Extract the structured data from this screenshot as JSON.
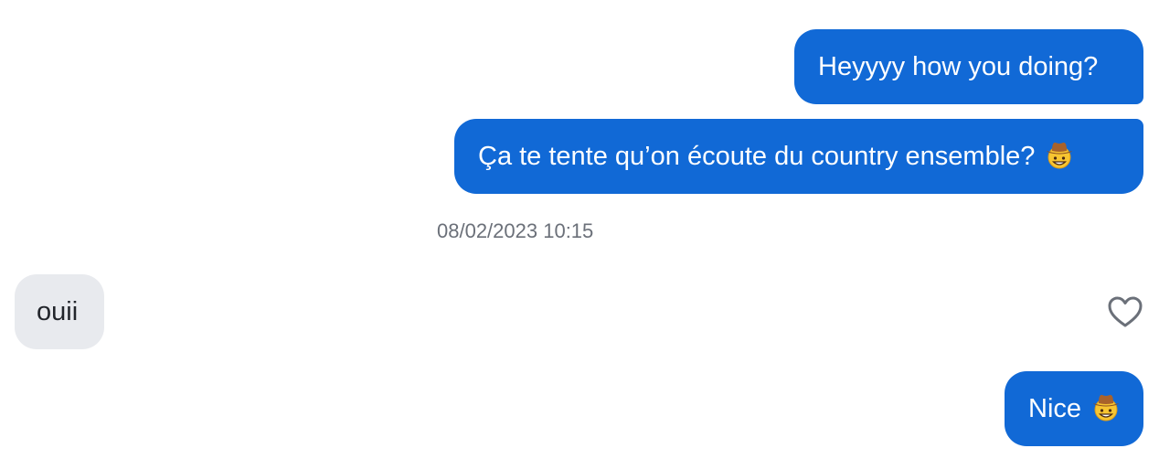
{
  "messages": [
    {
      "text": "Heyyyy how you doing?",
      "direction": "sent",
      "emoji": ""
    },
    {
      "text": "Ça te tente qu’on écoute du country ensemble? ",
      "direction": "sent",
      "emoji": "cowboy-hat-face-icon"
    },
    {
      "text": "ouii",
      "direction": "received",
      "emoji": ""
    },
    {
      "text": "Nice ",
      "direction": "sent",
      "emoji": "cowboy-hat-face-icon"
    }
  ],
  "timestamp": "08/02/2023 10:15",
  "like_icon": "heart-outline-icon",
  "colors": {
    "sent_bubble": "#1169d6",
    "received_bubble": "#e8eaee",
    "timestamp_text": "#6b7079",
    "icon_gray": "#6b7079"
  }
}
